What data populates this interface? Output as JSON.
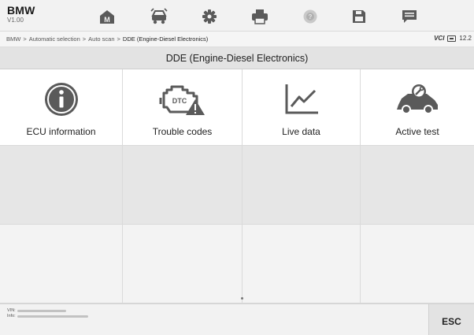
{
  "app": {
    "brand": "BMW",
    "version": "V1.00"
  },
  "toolbar": [
    {
      "name": "home-button",
      "icon": "home-icon"
    },
    {
      "name": "vehicle-swap-button",
      "icon": "vehicle-swap-icon"
    },
    {
      "name": "settings-button",
      "icon": "gear-icon"
    },
    {
      "name": "print-button",
      "icon": "printer-icon"
    },
    {
      "name": "help-button",
      "icon": "help-icon"
    },
    {
      "name": "save-button",
      "icon": "save-icon"
    },
    {
      "name": "data-logging-button",
      "icon": "message-icon"
    }
  ],
  "breadcrumb": {
    "items": [
      "BMW",
      "Automatic selection",
      "Auto scan",
      "DDE (Engine-Diesel Electronics)"
    ],
    "separator": ">"
  },
  "status": {
    "vci": "VCI",
    "voltage": "12.2"
  },
  "page_title": "DDE (Engine-Diesel Electronics)",
  "functions": [
    {
      "label": "ECU information",
      "icon": "info-icon"
    },
    {
      "label": "Trouble codes",
      "icon": "engine-warning-icon",
      "icon_text": "DTC"
    },
    {
      "label": "Live data",
      "icon": "line-chart-icon"
    },
    {
      "label": "Active test",
      "icon": "car-wrench-icon"
    }
  ],
  "footer": {
    "vin_label": "VIN:",
    "info_label": "Info:",
    "esc_label": "ESC"
  },
  "colors": {
    "icon": "#5a5a5a",
    "grid_shade": "#e6e6e6",
    "grid_light": "#f3f3f3",
    "title_bar": "#e3e3e3"
  }
}
